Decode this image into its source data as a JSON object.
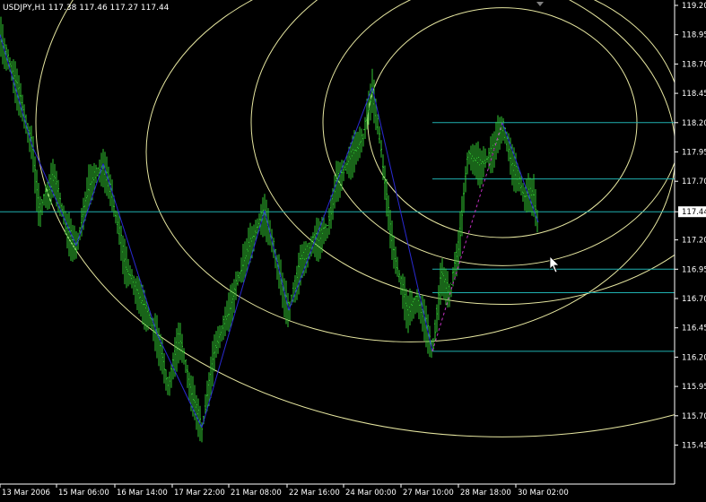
{
  "window": {
    "symbol": "USDJPY,H1",
    "ohlc": "117.38 117.46 117.27 117.44"
  },
  "colors": {
    "background": "#000000",
    "bars": "#32c832",
    "zigzag": "#2a2ad2",
    "zigzag_dashed": "#c030c0",
    "fibo_levels": "#20b0b0",
    "arcs": "#e6e6a0",
    "grid_frame": "#ffffff",
    "axis_text": "#ffffff",
    "price_tag_bg": "#ffffff",
    "price_tag_text": "#000000"
  },
  "chart_data": {
    "type": "candlestick-bars",
    "title": "",
    "xlabel": "",
    "ylabel": "",
    "ylim": [
      115.45,
      119.2
    ],
    "y_ticks": [
      "119.20",
      "118.95",
      "118.70",
      "118.45",
      "118.20",
      "117.95",
      "117.70",
      "117.44",
      "117.20",
      "116.95",
      "116.70",
      "116.45",
      "116.20",
      "115.95",
      "115.70",
      "115.45"
    ],
    "y_tick_values": [
      119.2,
      118.95,
      118.7,
      118.45,
      118.2,
      117.95,
      117.7,
      117.44,
      117.2,
      116.95,
      116.7,
      116.45,
      116.2,
      115.95,
      115.7,
      115.45
    ],
    "x_ticks": [
      "13 Mar 2006",
      "15 Mar 06:00",
      "16 Mar 14:00",
      "17 Mar 22:00",
      "21 Mar 08:00",
      "22 Mar 16:00",
      "24 Mar 00:00",
      "27 Mar 10:00",
      "28 Mar 18:00",
      "30 Mar 02:00"
    ],
    "current_price": 117.44,
    "current_price_label": "117.44",
    "zigzag_points": [
      [
        0,
        118.95
      ],
      [
        36,
        118.0
      ],
      [
        85,
        117.15
      ],
      [
        115,
        117.85
      ],
      [
        175,
        116.4
      ],
      [
        225,
        115.6
      ],
      [
        295,
        117.45
      ],
      [
        322,
        116.6
      ],
      [
        415,
        118.5
      ],
      [
        482,
        116.25
      ],
      [
        560,
        118.2
      ],
      [
        600,
        117.35
      ]
    ],
    "price_path": [
      [
        0,
        118.95
      ],
      [
        18,
        118.55
      ],
      [
        36,
        118.0
      ],
      [
        44,
        117.45
      ],
      [
        60,
        117.75
      ],
      [
        75,
        117.3
      ],
      [
        85,
        117.15
      ],
      [
        100,
        117.7
      ],
      [
        115,
        117.85
      ],
      [
        125,
        117.6
      ],
      [
        140,
        117.0
      ],
      [
        160,
        116.65
      ],
      [
        175,
        116.4
      ],
      [
        188,
        115.95
      ],
      [
        200,
        116.4
      ],
      [
        212,
        115.95
      ],
      [
        225,
        115.6
      ],
      [
        240,
        116.3
      ],
      [
        255,
        116.6
      ],
      [
        270,
        117.0
      ],
      [
        285,
        117.3
      ],
      [
        295,
        117.45
      ],
      [
        305,
        117.15
      ],
      [
        315,
        116.8
      ],
      [
        322,
        116.6
      ],
      [
        335,
        117.0
      ],
      [
        350,
        117.2
      ],
      [
        365,
        117.3
      ],
      [
        375,
        117.7
      ],
      [
        390,
        117.9
      ],
      [
        405,
        118.1
      ],
      [
        415,
        118.5
      ],
      [
        425,
        118.0
      ],
      [
        435,
        117.3
      ],
      [
        445,
        116.9
      ],
      [
        455,
        116.6
      ],
      [
        465,
        116.7
      ],
      [
        475,
        116.5
      ],
      [
        482,
        116.25
      ],
      [
        492,
        116.9
      ],
      [
        502,
        116.75
      ],
      [
        512,
        117.2
      ],
      [
        522,
        117.95
      ],
      [
        535,
        117.85
      ],
      [
        548,
        117.95
      ],
      [
        560,
        118.2
      ],
      [
        572,
        117.85
      ],
      [
        585,
        117.6
      ],
      [
        595,
        117.6
      ],
      [
        600,
        117.35
      ]
    ],
    "fibo_levels": [
      118.2,
      117.72,
      117.44,
      116.95,
      116.75,
      116.25
    ],
    "arcs": [
      {
        "cx": 458,
        "cy": 117.95,
        "rx": 295,
        "ry": 1.62
      },
      {
        "cx": 560,
        "cy": 118.2,
        "rx": 150,
        "ry": 0.98
      },
      {
        "cx": 560,
        "cy": 118.2,
        "rx": 200,
        "ry": 1.22
      },
      {
        "cx": 560,
        "cy": 118.2,
        "rx": 280,
        "ry": 1.55
      },
      {
        "cx": 560,
        "cy": 118.2,
        "rx": 520,
        "ry": 2.68
      }
    ]
  }
}
